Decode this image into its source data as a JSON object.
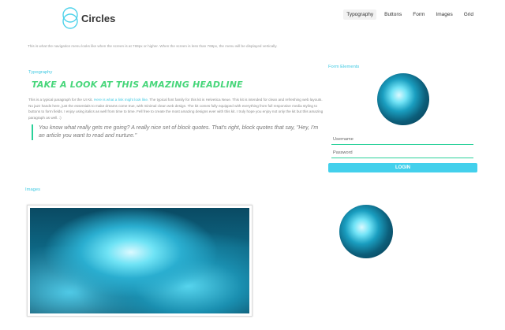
{
  "brand": {
    "name": "Circles",
    "logo_icon": "circles-logo-icon",
    "accent": "#3ec9e2"
  },
  "nav": {
    "items": [
      {
        "label": "Typography",
        "active": true
      },
      {
        "label": "Buttons",
        "active": false
      },
      {
        "label": "Form",
        "active": false
      },
      {
        "label": "Images",
        "active": false
      },
      {
        "label": "Grid",
        "active": false
      }
    ],
    "note": "This is what the navigation menu looks like when the screen is at 769px or higher. When the screen is less than 769px, the menu will be displayed vertically."
  },
  "typography": {
    "section_title": "Typography",
    "headline": "Take a look at this amazing headline",
    "headline_color": "#47d67a",
    "paragraph_before": "This is a typical paragraph for the UI Kit. ",
    "paragraph_link": "Here is what a link might look like.",
    "paragraph_after": " The typical font family for this kit is Helvetica Neue. This kit is intended for clean and refreshing web layouts. No jazz hands here, just the essentials to make dreams come true, with minimal clean web design. The kit comes fully equipped with everything from full responsive media styling to buttons to form fields. I enjoy using italics as well from time to time. Fell free to create the most amazing designs ever with this kit. I truly hope you enjoy not only the kit but this amazing paragraph as well. :)",
    "quote": "You know what really gets me going? A really nice set of block quotes. That's right, block quotes that say, \"Hey, I'm an article you want to read and nurture.\""
  },
  "form": {
    "section_title": "Form Elements",
    "username_placeholder": "Username",
    "password_placeholder": "Password",
    "login_label": "LOGIN",
    "field_line_color": "#2ad19a",
    "button_color": "#43d0ec"
  },
  "images": {
    "section_title": "Images"
  }
}
